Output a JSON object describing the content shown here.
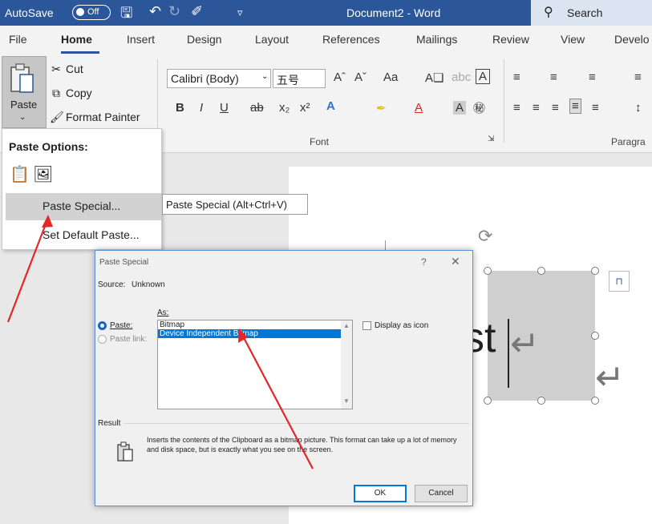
{
  "titlebar": {
    "autosave_label": "AutoSave",
    "autosave_state": "Off",
    "document_title": "Document2 - Word",
    "search_label": "Search",
    "save_icon": "save-icon",
    "undo_icon": "undo-icon",
    "redo_icon": "redo-icon",
    "format_icon": "format-icon",
    "customize_icon": "customize-icon"
  },
  "ribbon_tabs": [
    "File",
    "Home",
    "Insert",
    "Design",
    "Layout",
    "References",
    "Mailings",
    "Review",
    "View",
    "Develo"
  ],
  "clipboard": {
    "paste_label": "Paste",
    "cut_label": "Cut",
    "copy_label": "Copy",
    "format_painter_label": "Format Painter"
  },
  "font": {
    "font_name": "Calibri (Body)",
    "font_size": "五号",
    "group_label": "Font",
    "aa_label": "Aa"
  },
  "paragraph": {
    "group_label": "Paragra"
  },
  "paste_menu": {
    "heading": "Paste Options:",
    "paste_special": "Paste Special...",
    "set_default": "Set Default Paste..."
  },
  "tooltip": "Paste Special (Alt+Ctrl+V)",
  "document": {
    "shape_text": "st"
  },
  "dialog": {
    "title": "Paste Special",
    "help": "?",
    "close": "✕",
    "source_label": "Source:",
    "source_value": "Unknown",
    "as_label": "As:",
    "paste_label": "Paste:",
    "paste_link_label": "Paste link:",
    "formats": [
      "Bitmap",
      "Device Independent Bitmap"
    ],
    "selected_format": 1,
    "display_as_icon": "Display as icon",
    "result_label": "Result",
    "result_text": "Inserts the contents of the Clipboard as a bitmap picture. This format can take up a lot of memory and disk space, but is exactly what you see on the screen.",
    "ok": "OK",
    "cancel": "Cancel"
  },
  "colors": {
    "titlebar": "#2b579a",
    "selection": "#0078d7",
    "annotation_arrow": "#e32626"
  }
}
